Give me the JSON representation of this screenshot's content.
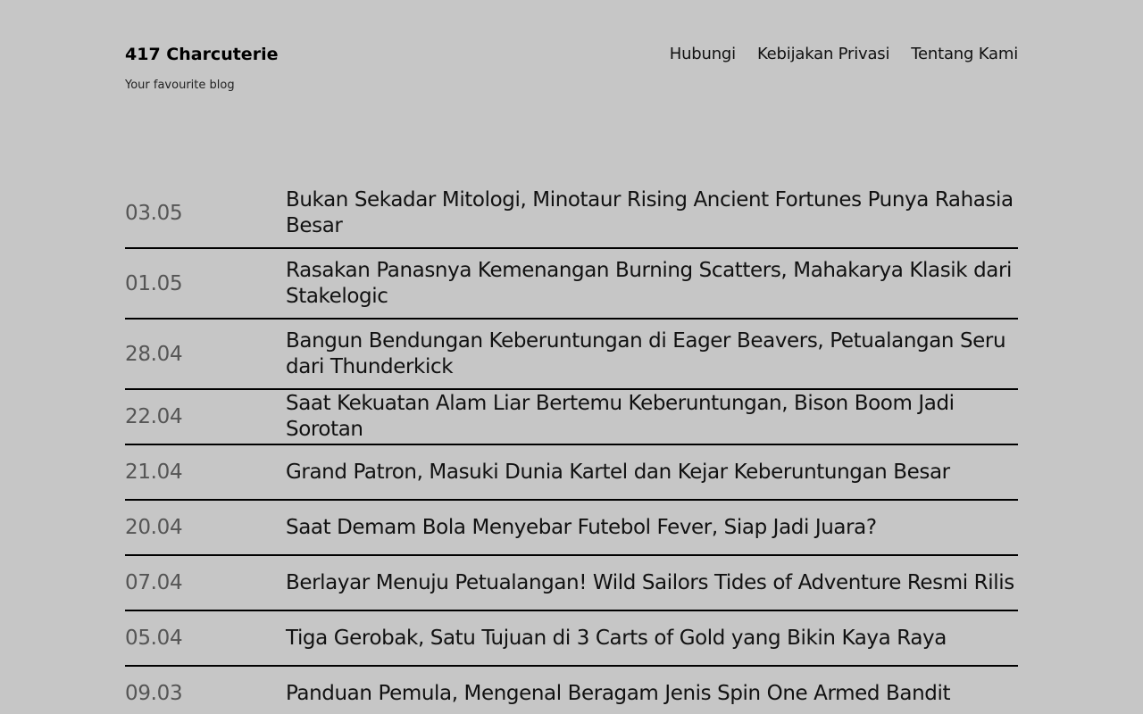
{
  "site": {
    "title": "417 Charcuterie",
    "tagline": "Your favourite blog"
  },
  "nav": {
    "items": [
      {
        "label": "Hubungi"
      },
      {
        "label": "Kebijakan Privasi"
      },
      {
        "label": "Tentang Kami"
      }
    ]
  },
  "posts": [
    {
      "date": "03.05",
      "title": "Bukan Sekadar Mitologi, Minotaur Rising Ancient Fortunes Punya Rahasia Besar"
    },
    {
      "date": "01.05",
      "title": "Rasakan Panasnya Kemenangan Burning Scatters, Mahakarya Klasik dari Stakelogic"
    },
    {
      "date": "28.04",
      "title": "Bangun Bendungan Keberuntungan di Eager Beavers, Petualangan Seru dari Thunderkick"
    },
    {
      "date": "22.04",
      "title": "Saat Kekuatan Alam Liar Bertemu Keberuntungan, Bison Boom Jadi Sorotan"
    },
    {
      "date": "21.04",
      "title": "Grand Patron, Masuki Dunia Kartel dan Kejar Keberuntungan Besar"
    },
    {
      "date": "20.04",
      "title": "Saat Demam Bola Menyebar Futebol Fever, Siap Jadi Juara?"
    },
    {
      "date": "07.04",
      "title": "Berlayar Menuju Petualangan! Wild Sailors Tides of Adventure Resmi Rilis"
    },
    {
      "date": "05.04",
      "title": "Tiga Gerobak, Satu Tujuan di 3 Carts of Gold yang Bikin Kaya Raya"
    },
    {
      "date": "09.03",
      "title": "Panduan Pemula, Mengenal Beragam Jenis Spin One Armed Bandit"
    }
  ]
}
